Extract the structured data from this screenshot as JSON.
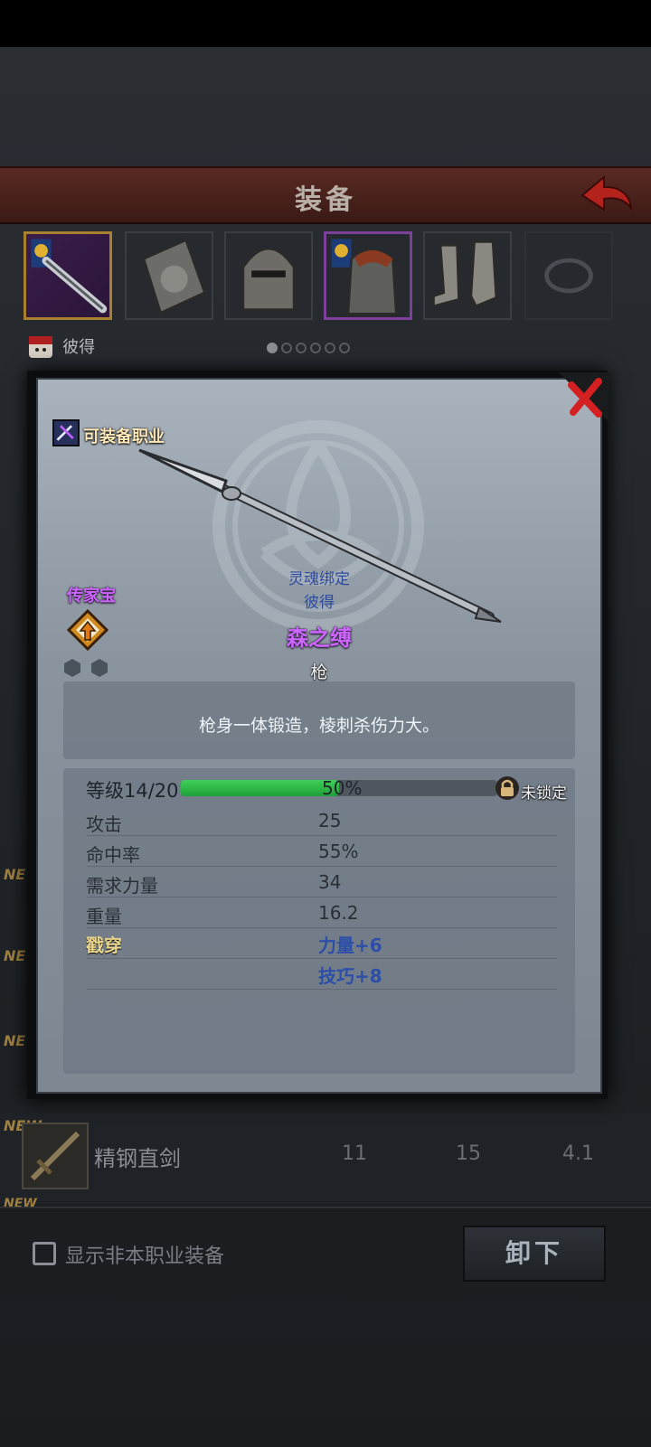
{
  "header": {
    "title": "装备"
  },
  "owner": {
    "name": "彼得"
  },
  "pagination": {
    "total": 6,
    "active": 0
  },
  "popup": {
    "class_label": "可装备职业",
    "heirloom_label": "传家宝",
    "soulbound": "灵魂绑定",
    "bound_to": "彼得",
    "item_name": "森之缚",
    "item_type": "枪",
    "description": "枪身一体锻造，棱刺杀伤力大。",
    "level_label": "等级",
    "level_value": "14/20",
    "progress_text": "50%",
    "progress_fraction": 0.5,
    "lock_label": "未锁定",
    "stats": [
      {
        "label": "攻击",
        "value": "25"
      },
      {
        "label": "命中率",
        "value": "55%"
      },
      {
        "label": "需求力量",
        "value": "34"
      },
      {
        "label": "重量",
        "value": "16.2"
      },
      {
        "label": "戳穿",
        "value": "力量+6"
      },
      {
        "label": "",
        "value": "技巧+8"
      }
    ]
  },
  "list": {
    "new_tags": [
      "NEW",
      "NEW",
      "NEW",
      "NEW",
      "NEW"
    ],
    "item": {
      "name": "精钢直剑",
      "col1": "11",
      "col2": "15",
      "col3": "4.1"
    }
  },
  "footer": {
    "checkbox_label": "显示非本职业装备",
    "unequip_label": "卸下"
  },
  "colors": {
    "accent_red": "#c41f1f",
    "progress_green": "#2fbf4a",
    "rarity_purple": "#cc66ff"
  }
}
